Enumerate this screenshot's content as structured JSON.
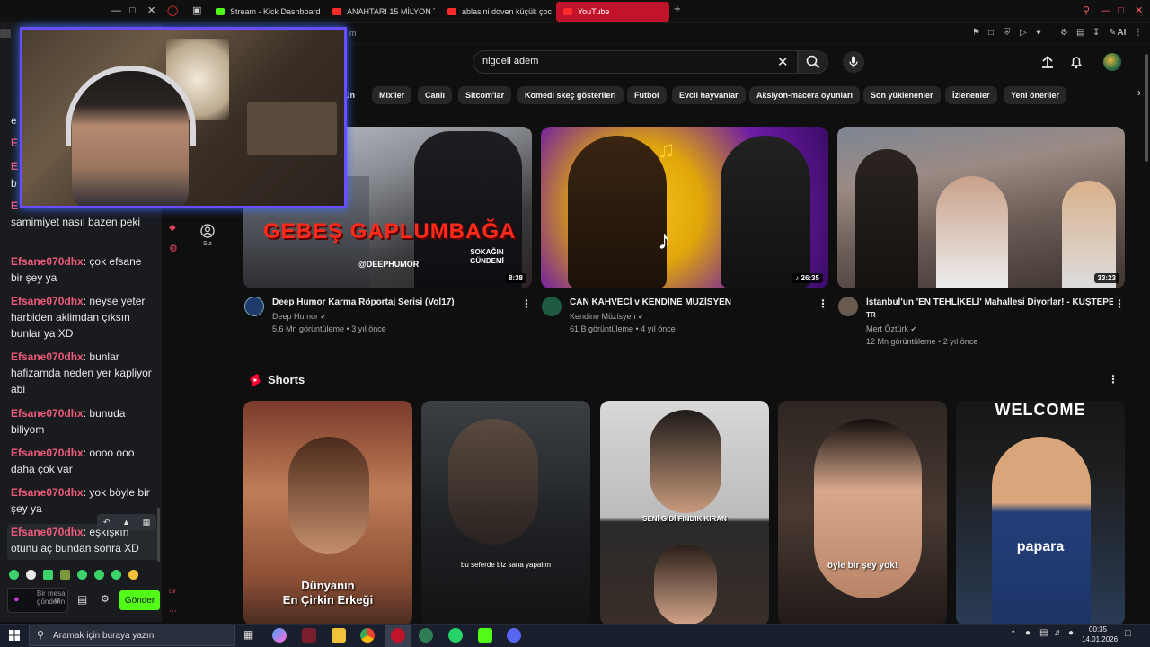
{
  "browser": {
    "tabs": [
      {
        "label": "Stream - Kick Dashboard",
        "color": "#53fc18"
      },
      {
        "label": "ANAHTARI 15 MİLYON TL",
        "color": "#ff2b2b"
      },
      {
        "label": "ablasini doven küçük çocu",
        "color": "#ff2b2b"
      },
      {
        "label": "YouTube",
        "color": "#ff2b2b"
      }
    ],
    "address_fragment": "m",
    "ai_label": "AI"
  },
  "youtube": {
    "search_value": "nigdeli adem",
    "left_nav": {
      "you_label": "Siz"
    },
    "chips": [
      "Mix'ler",
      "Canlı",
      "Sitcom'lar",
      "Komedi skeç gösterileri",
      "Futbol",
      "Evcil hayvanlar",
      "Aksiyon-macera oyunları",
      "Son yüklenenler",
      "İzlenenler",
      "Yeni öneriler"
    ],
    "chip_partial": "ün",
    "videos": [
      {
        "title": "Deep Humor Karma Röportaj Serisi (Vol17)",
        "channel": "Deep Humor",
        "stats": "5,6 Mn görüntüleme • 3 yıl önce",
        "duration": "8:38",
        "overlay": "GEBEŞ GAPLUMBAĞA",
        "overlay2": "@DEEPHUMOR",
        "overlay3": "SOKAĞIN GÜNDEMİ"
      },
      {
        "title": "CAN KAHVECİ v KENDİNE MÜZİSYEN",
        "channel": "Kendine Müzisyen",
        "stats": "61 B görüntüleme • 4 yıl önce",
        "duration": "26:35",
        "overlay": "",
        "overlay2": "",
        "overlay3": ""
      },
      {
        "title": "İstanbul'un 'EN TEHLİKELİ' Mahallesi Diyorlar! - KUŞTEPE",
        "title2": "TR",
        "channel": "Mert Öztürk",
        "stats": "12 Mn görüntüleme • 2 yıl önce",
        "duration": "33:23",
        "overlay": "",
        "overlay2": "",
        "overlay3": ""
      }
    ],
    "shorts_label": "Shorts",
    "shorts": [
      {
        "caption": "Dünyanın\nEn Çirkin Erkeği"
      },
      {
        "caption": "bu seferde biz sana yapalım"
      },
      {
        "caption": "SENİ GİDİ FINDIK KIRAN"
      },
      {
        "caption": "öyle bir şey yok!"
      },
      {
        "caption": "WELCOME",
        "caption2": "papara"
      }
    ]
  },
  "chat": {
    "partial_lines": [
      "e",
      "E",
      "E",
      "b",
      "E"
    ],
    "messages": [
      {
        "user": "",
        "text": "samimiyet nasıl bazen peki"
      },
      {
        "user": "Efsane070dhx",
        "text": "çok efsane bir şey ya"
      },
      {
        "user": "Efsane070dhx",
        "text": "neyse yeter harbiden aklimdan çıksın bunlar ya XD"
      },
      {
        "user": "Efsane070dhx",
        "text": "bunlar hafizamda neden yer kapliyor abi"
      },
      {
        "user": "Efsane070dhx",
        "text": "bunuda biliyom"
      },
      {
        "user": "Efsane070dhx",
        "text": "oooo ooo daha çok var"
      },
      {
        "user": "Efsane070dhx",
        "text": "yok böyle bir şey ya"
      },
      {
        "user": "Efsane070dhx",
        "text": "eşkışkın otunu aç bundan sonra XD"
      }
    ],
    "input_placeholder": "Bir mesaj gönderin",
    "send_label": "Gönder",
    "side_label": "Gir"
  },
  "taskbar": {
    "search_placeholder": "Aramak için buraya yazın",
    "time": "00:35",
    "date": "14.01.2026"
  }
}
